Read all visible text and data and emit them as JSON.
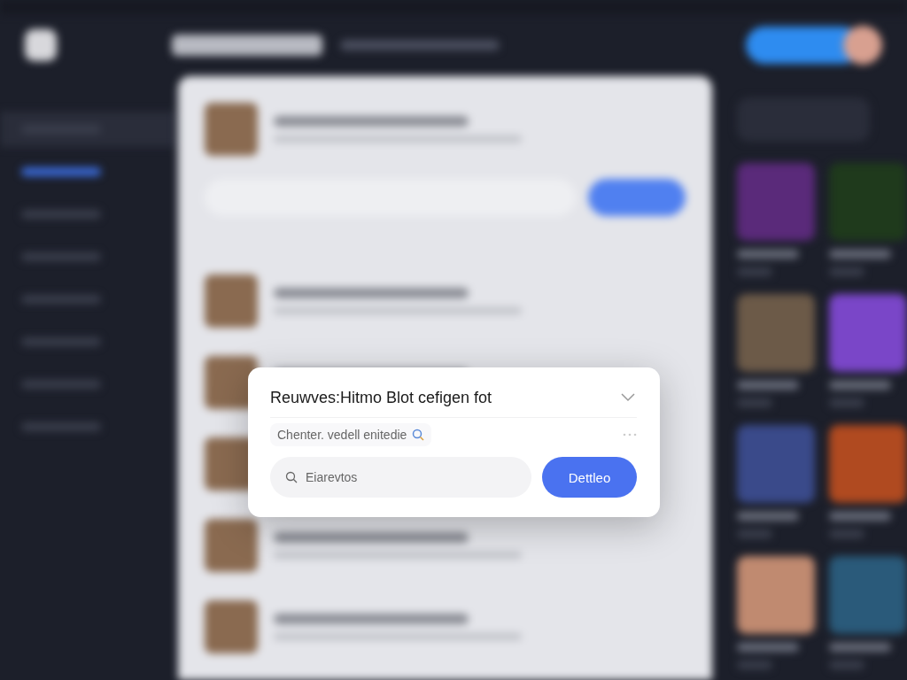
{
  "dialog": {
    "title": "Reuwves:Hitmo Blot cefigen fot",
    "subtitle": "Chenter. vedell enitedie",
    "search": {
      "placeholder": "Eiarevtos"
    },
    "button": "Dettleo"
  }
}
